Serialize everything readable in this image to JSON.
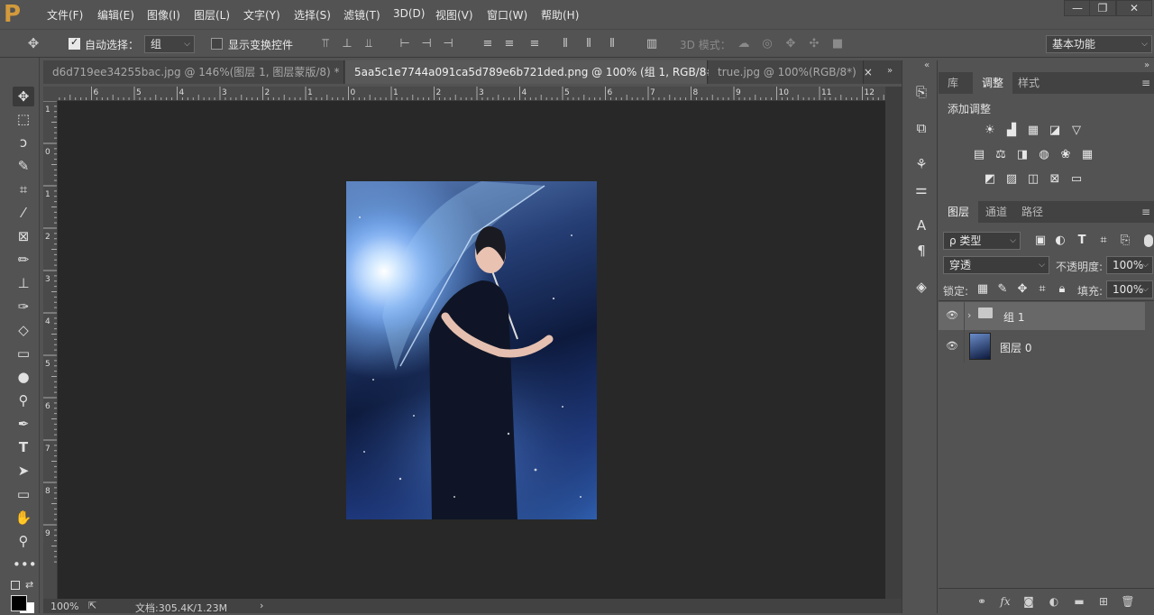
{
  "logo_text": "P",
  "menu": [
    "文件(F)",
    "编辑(E)",
    "图像(I)",
    "图层(L)",
    "文字(Y)",
    "选择(S)",
    "滤镜(T)",
    "3D(D)",
    "视图(V)",
    "窗口(W)",
    "帮助(H)"
  ],
  "window_controls": {
    "minimize": "—",
    "restore": "❐",
    "close": "✕"
  },
  "options": {
    "auto_select_label": "自动选择：",
    "auto_select_value": "组",
    "show_transform_label": "显示变换控件",
    "mode_3d_label": "3D 模式：",
    "workspace": "基本功能"
  },
  "tabs": [
    {
      "label": "d6d719ee34255bac.jpg @ 146%(图层 1, 图层蒙版/8) *",
      "close": "×"
    },
    {
      "label": "5aa5c1e7744a091ca5d789e6b721ded.png @ 100% (组 1, RGB/8#) *",
      "close": "×"
    },
    {
      "label": "true.jpg @ 100%(RGB/8*)",
      "close": "×"
    }
  ],
  "hruler": [
    "7",
    "6",
    "5",
    "4",
    "3",
    "2",
    "1",
    "0",
    "1",
    "2",
    "3",
    "4",
    "5",
    "6",
    "7",
    "8",
    "9",
    "10",
    "11",
    "12"
  ],
  "vruler": [
    "1",
    "0",
    "1",
    "2",
    "3",
    "4",
    "5",
    "6",
    "7",
    "8",
    "9"
  ],
  "status": {
    "zoom": "100%",
    "doc": "文档:305.4K/1.23M",
    "arrow": "›"
  },
  "adjust_panel": {
    "tabs": [
      "库",
      "调整",
      "样式"
    ],
    "title": "添加调整"
  },
  "layers_panel": {
    "tabs": [
      "图层",
      "通道",
      "路径"
    ],
    "filter": "ρ 类型",
    "blend": "穿透",
    "opacity_label": "不透明度:",
    "opacity": "100%",
    "lock_label": "锁定:",
    "fill_label": "填充:",
    "fill": "100%",
    "layers": [
      {
        "name": "组 1",
        "type": "group"
      },
      {
        "name": "图层 0",
        "type": "pixel"
      }
    ]
  },
  "bottom_icons": [
    "link-icon",
    "fx-icon",
    "mask-icon",
    "adjustment-icon",
    "folder-icon",
    "new-layer-icon",
    "trash-icon"
  ]
}
